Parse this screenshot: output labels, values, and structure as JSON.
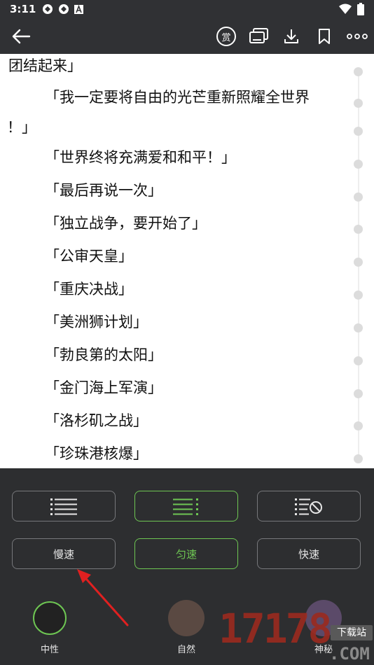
{
  "status_bar": {
    "time": "3:11",
    "left_icons": [
      "app-notification-icon",
      "app-notification-icon",
      "a-badge-icon"
    ],
    "right_icons": [
      "wifi-icon",
      "battery-icon"
    ]
  },
  "toolbar": {
    "reward_label": "赏",
    "icons": [
      "back-arrow-icon",
      "reward-icon",
      "screen-cast-icon",
      "download-icon",
      "bookmark-icon",
      "more-icon"
    ]
  },
  "content": {
    "lines": [
      "团结起来」",
      "「我一定要将自由的光芒重新照耀全世界",
      "！」",
      "「世界终将充满爱和和平！」",
      "「最后再说一次」",
      "「独立战争，要开始了」",
      "「公审天皇」",
      "「重庆决战」",
      "「美洲狮计划」",
      "「勃良第的太阳」",
      "「金门海上军演」",
      "「洛杉矶之战」",
      "「珍珠港核爆」"
    ]
  },
  "panel": {
    "layout_modes": [
      "list-icon",
      "list-dotted-icon",
      "list-no-icon"
    ],
    "layout_active": 1,
    "speeds": [
      "慢速",
      "匀速",
      "快速"
    ],
    "speed_active": 1,
    "voices": [
      {
        "label": "中性",
        "color": "#222222",
        "ring": "#6ec653"
      },
      {
        "label": "自然",
        "color": "#5a4942"
      },
      {
        "label": "神秘",
        "color": "#5b4a69"
      }
    ]
  },
  "watermark": {
    "number": "17178",
    "tag": "下载站",
    "suffix": ".COM"
  },
  "colors": {
    "bar_bg": "#303134",
    "panel_bg": "#2d2e30",
    "accent": "#6ec653",
    "arrow": "#e02020"
  }
}
